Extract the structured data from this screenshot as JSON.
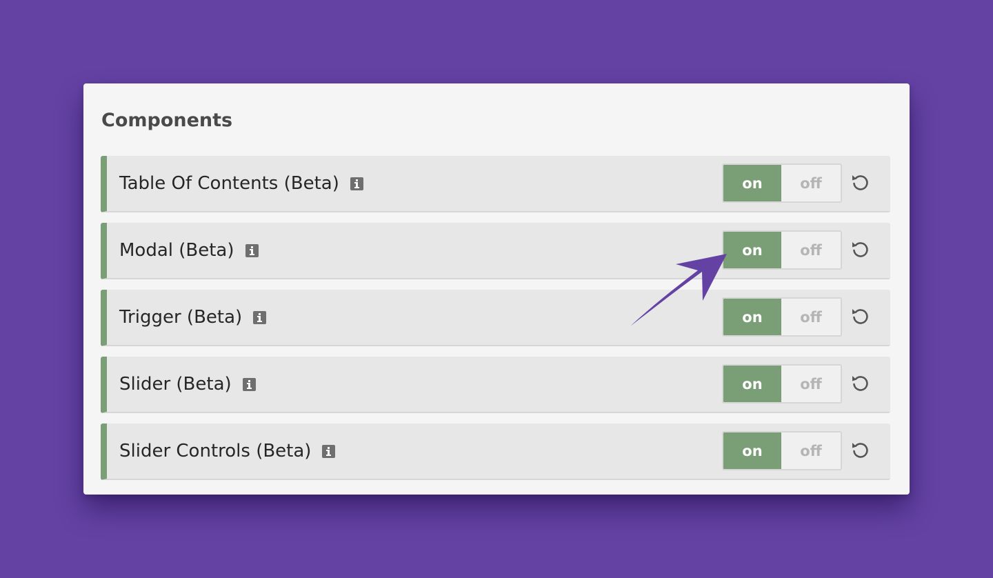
{
  "panel": {
    "title": "Components"
  },
  "rows": [
    {
      "label": "Table Of Contents (Beta)",
      "info_icon": "info-icon",
      "toggle": {
        "on_label": "on",
        "off_label": "off",
        "state": "on"
      },
      "reset_icon": "reset-icon"
    },
    {
      "label": "Modal (Beta)",
      "info_icon": "info-icon",
      "toggle": {
        "on_label": "on",
        "off_label": "off",
        "state": "on"
      },
      "reset_icon": "reset-icon"
    },
    {
      "label": "Trigger (Beta)",
      "info_icon": "info-icon",
      "toggle": {
        "on_label": "on",
        "off_label": "off",
        "state": "on"
      },
      "reset_icon": "reset-icon"
    },
    {
      "label": "Slider (Beta)",
      "info_icon": "info-icon",
      "toggle": {
        "on_label": "on",
        "off_label": "off",
        "state": "on"
      },
      "reset_icon": "reset-icon"
    },
    {
      "label": "Slider Controls (Beta)",
      "info_icon": "info-icon",
      "toggle": {
        "on_label": "on",
        "off_label": "off",
        "state": "on"
      },
      "reset_icon": "reset-icon"
    }
  ],
  "colors": {
    "background": "#6442a4",
    "panel": "#f5f5f5",
    "row": "#e7e7e7",
    "accent_green": "#7a9e76",
    "arrow": "#6442a4"
  },
  "annotation": {
    "icon": "arrow-pointer-icon"
  }
}
